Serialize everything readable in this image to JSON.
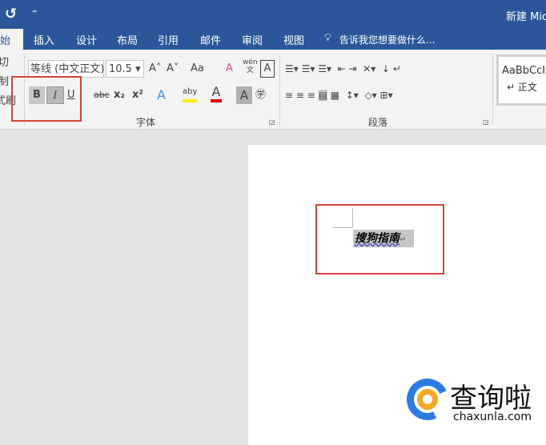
{
  "titlebar": {
    "undo_icon": "undo-icon",
    "qat": "⁼",
    "title": "新建 Mic"
  },
  "tabs": [
    {
      "label": "开始"
    },
    {
      "label": "插入"
    },
    {
      "label": "设计"
    },
    {
      "label": "布局"
    },
    {
      "label": "引用"
    },
    {
      "label": "邮件"
    },
    {
      "label": "审阅"
    },
    {
      "label": "视图"
    }
  ],
  "tell_me": "告诉我您想要做什么...",
  "clipboard": {
    "cut": "切",
    "copy": "制",
    "format_painter": "式刷"
  },
  "font": {
    "name": "等线 (中文正文)",
    "size": "10.5",
    "grow": "A˄",
    "shrink": "A˅",
    "case": "Aa",
    "bold": "B",
    "italic": "I",
    "underline": "U",
    "strike": "abc",
    "subscript": "x₂",
    "superscript": "x²",
    "effects": "A",
    "highlight": "aby",
    "font_color": "A",
    "shading": "A",
    "enclose": "㊫",
    "phonetic": "wén\n文",
    "char_border": "A",
    "group_label": "字体"
  },
  "paragraph": {
    "group_label": "段落"
  },
  "styles": {
    "preview": "AaBbCcI",
    "name": "↵ 正文"
  },
  "document": {
    "text": "搜狗指南",
    "para_mark": "↵"
  },
  "watermark": {
    "brand": "查询啦",
    "url": "chaxunla.com"
  },
  "colors": {
    "accent": "#2b579a",
    "highlight": "#d9413b"
  }
}
